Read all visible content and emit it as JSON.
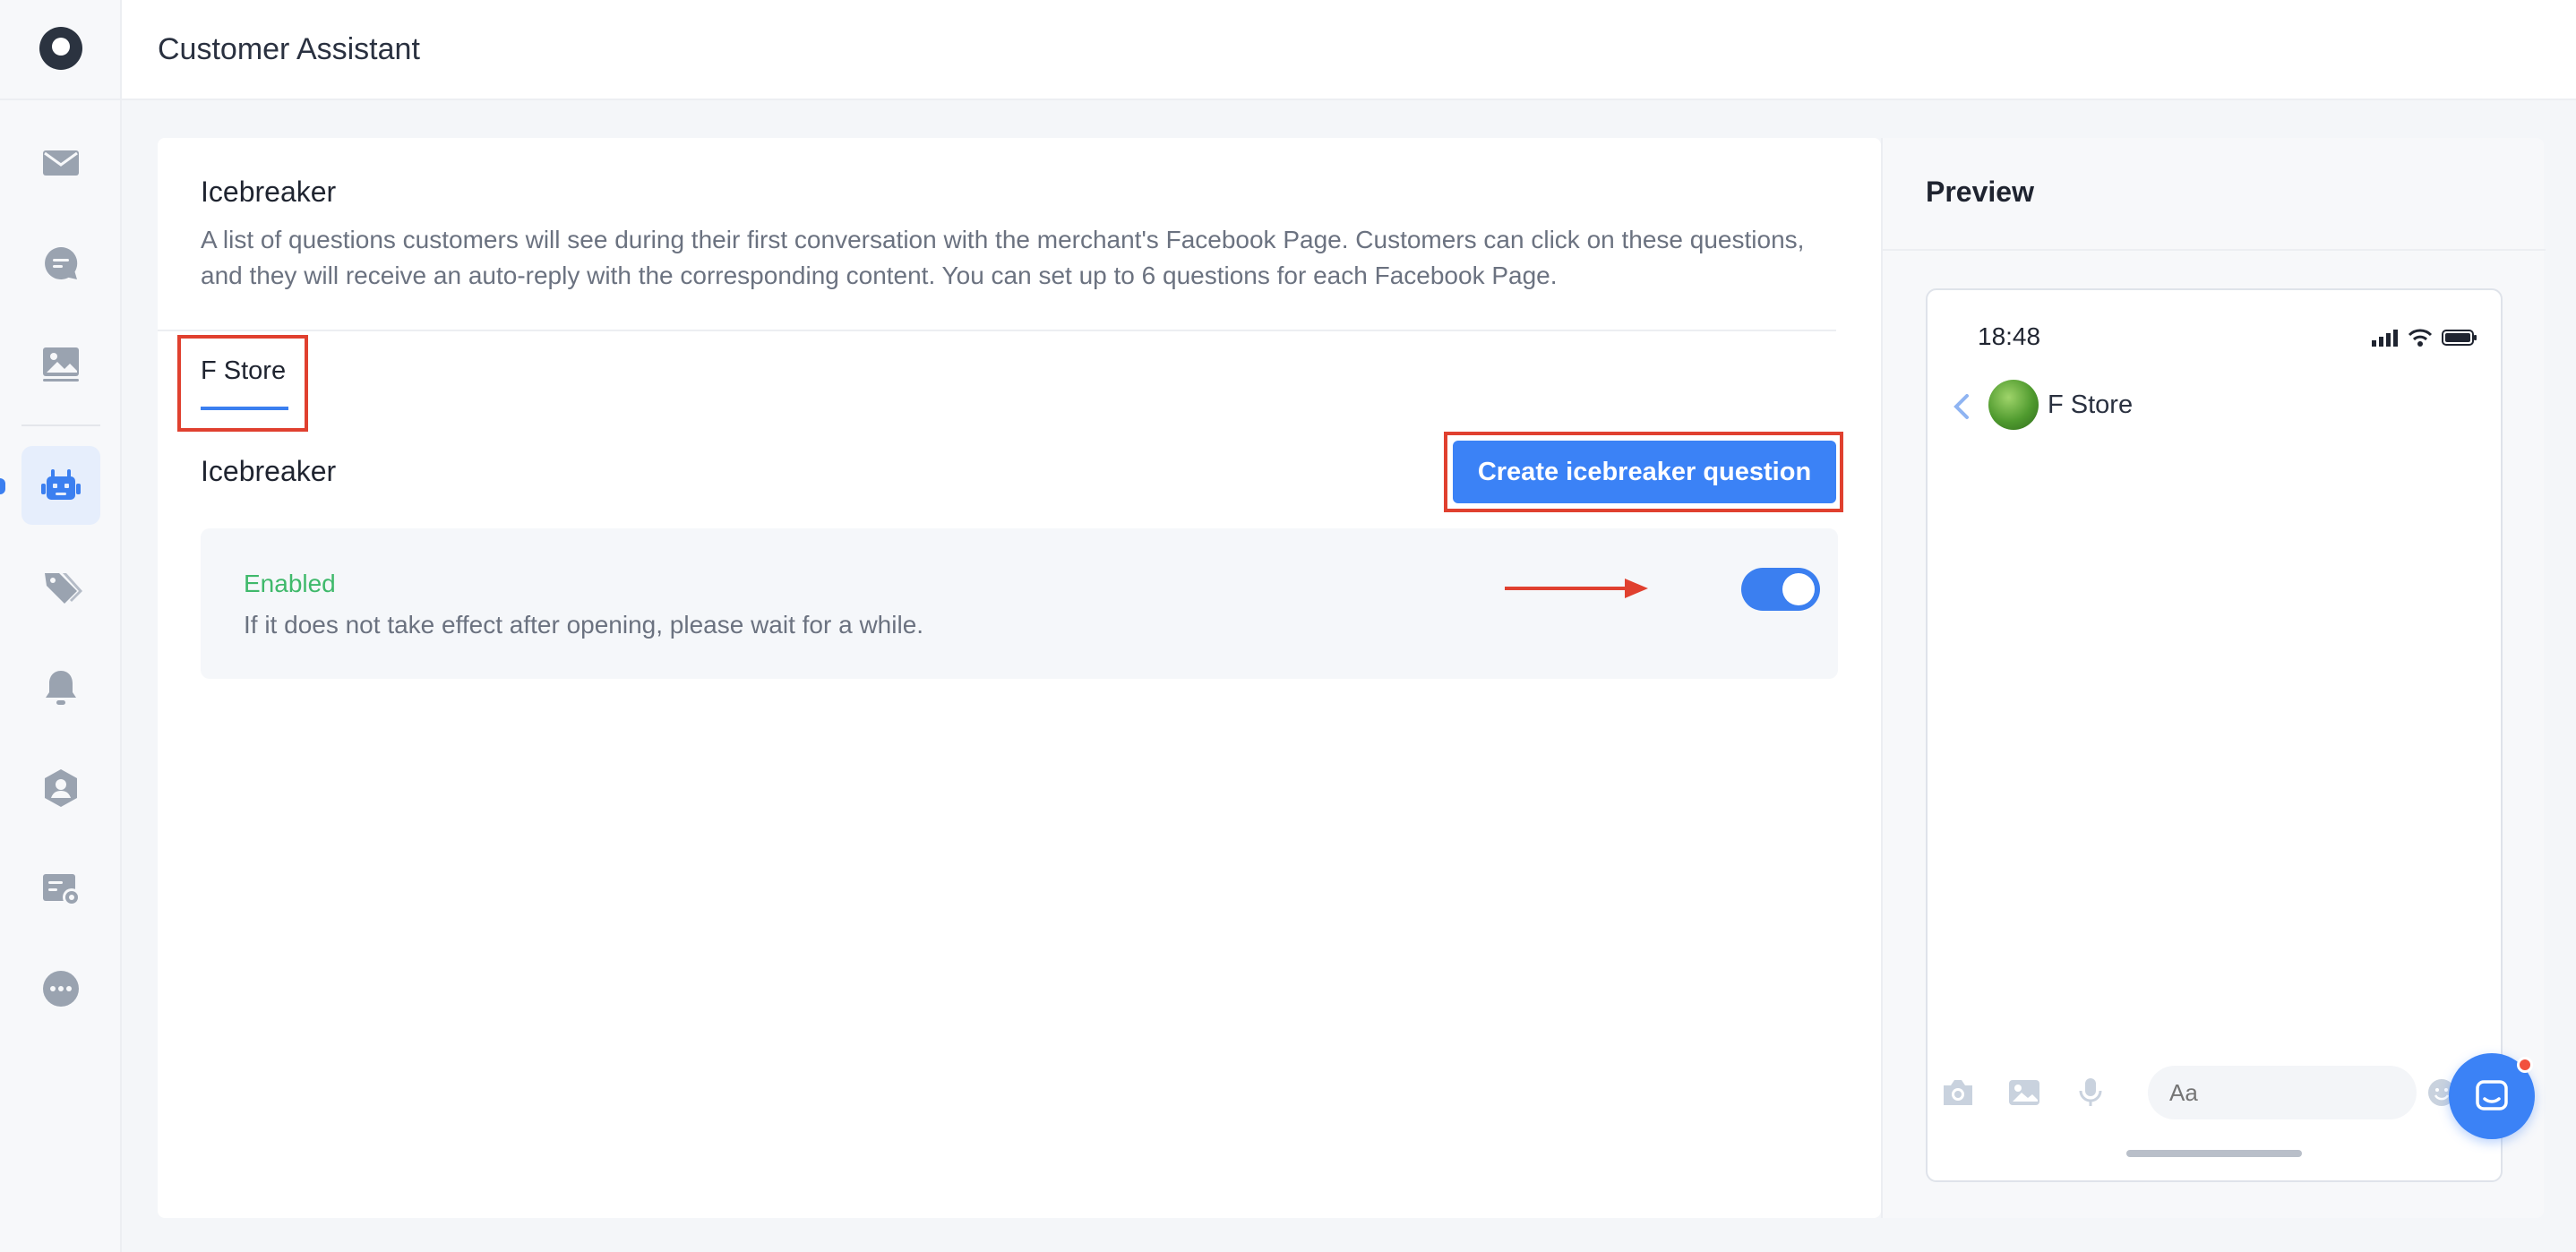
{
  "header": {
    "title": "Customer Assistant"
  },
  "sidebar": {
    "items": [
      {
        "name": "sidebar-item-inbox",
        "icon": "mail-icon"
      },
      {
        "name": "sidebar-item-chat",
        "icon": "chat-bubble-icon"
      },
      {
        "name": "sidebar-item-media",
        "icon": "image-icon"
      },
      {
        "name": "sidebar-item-bot",
        "icon": "robot-icon",
        "active": true
      },
      {
        "name": "sidebar-item-tags",
        "icon": "tag-icon"
      },
      {
        "name": "sidebar-item-notifications",
        "icon": "bell-icon"
      },
      {
        "name": "sidebar-item-contacts",
        "icon": "user-shield-icon"
      },
      {
        "name": "sidebar-item-settings",
        "icon": "card-gear-icon"
      },
      {
        "name": "sidebar-item-more",
        "icon": "more-icon"
      }
    ]
  },
  "main": {
    "title": "Icebreaker",
    "description": "A list of questions customers will see during their first conversation with the merchant's Facebook Page. Customers can click on these questions, and they will receive an auto-reply with the corresponding content. You can set up to 6 questions for each Facebook Page.",
    "tabs": [
      {
        "label": "F Store",
        "active": true
      }
    ],
    "section_title": "Icebreaker",
    "create_button": "Create icebreaker question",
    "status": {
      "label": "Enabled",
      "note": "If it does not take effect after opening, please wait for a while.",
      "enabled": true
    }
  },
  "preview": {
    "title": "Preview",
    "phone": {
      "time": "18:48",
      "page_name": "F Store",
      "input_placeholder": "Aa"
    }
  },
  "colors": {
    "accent": "#3b82f6",
    "enabled": "#3fb96b",
    "highlight": "#e0402f"
  }
}
